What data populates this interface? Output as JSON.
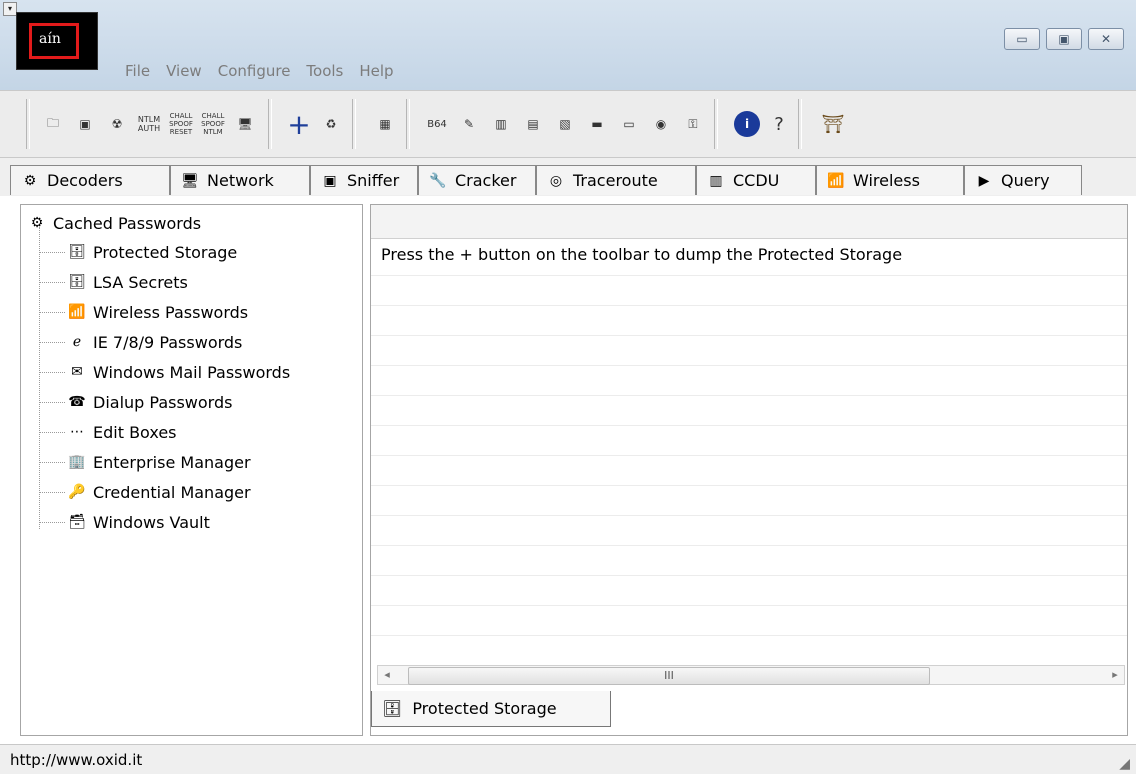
{
  "app": {
    "logo_text": "aín"
  },
  "window_controls": {
    "minimize": "▭",
    "restore": "▣",
    "close": "✕"
  },
  "menu": [
    "File",
    "View",
    "Configure",
    "Tools",
    "Help"
  ],
  "toolbar": {
    "labels": {
      "ntlm_auth": "NTLM AUTH",
      "chall_spoof_reset": "CHALL SPOOF RESET",
      "chall_spoof_ntlm": "CHALL SPOOF NTLM",
      "b64": "B64",
      "add": "+",
      "info": "i",
      "help": "?"
    }
  },
  "tabs": [
    {
      "label": "Decoders",
      "icon": "decoders-icon"
    },
    {
      "label": "Network",
      "icon": "network-icon"
    },
    {
      "label": "Sniffer",
      "icon": "sniffer-icon"
    },
    {
      "label": "Cracker",
      "icon": "cracker-icon"
    },
    {
      "label": "Traceroute",
      "icon": "traceroute-icon"
    },
    {
      "label": "CCDU",
      "icon": "ccdu-icon"
    },
    {
      "label": "Wireless",
      "icon": "wireless-icon"
    },
    {
      "label": "Query",
      "icon": "query-icon"
    }
  ],
  "tree": {
    "root": "Cached Passwords",
    "items": [
      "Protected Storage",
      "LSA Secrets",
      "Wireless Passwords",
      "IE 7/8/9 Passwords",
      "Windows Mail Passwords",
      "Dialup Passwords",
      "Edit Boxes",
      "Enterprise Manager",
      "Credential Manager",
      "Windows Vault"
    ]
  },
  "right_panel": {
    "message": "Press the + button on the toolbar to dump the Protected Storage",
    "scroll_center": "III",
    "bottom_tab": "Protected Storage"
  },
  "status": {
    "url": "http://www.oxid.it"
  },
  "colors": {
    "accent": "#e21b1b"
  }
}
